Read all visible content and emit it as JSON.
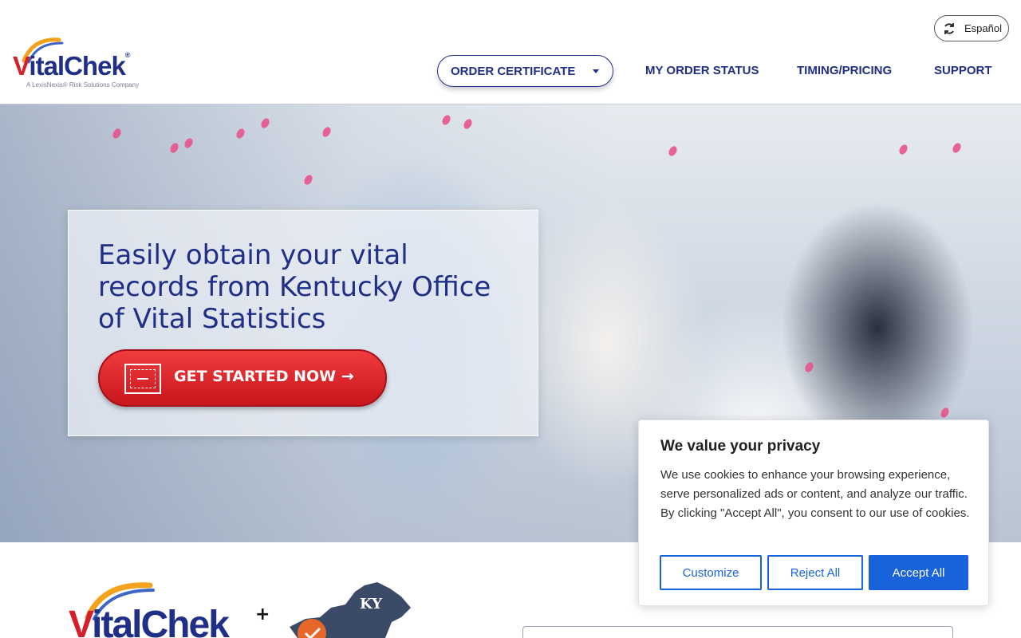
{
  "brand": {
    "logo_word": "VitalChek",
    "logo_tagline": "A LexisNexis® Risk Solutions Company",
    "colors": {
      "primary_navy": "#1f2e86",
      "brand_red": "#d41f2a",
      "cookie_blue": "#1863dc"
    }
  },
  "header": {
    "language_button": {
      "icon": "refresh-icon",
      "label": "Español"
    },
    "nav": {
      "order_certificate": "ORDER CERTIFICATE",
      "order_status": "MY ORDER STATUS",
      "timing_pricing": "TIMING/PRICING",
      "support": "SUPPORT"
    }
  },
  "hero": {
    "title": "Easily obtain your vital records from Kentucky Office of Vital Statistics",
    "cta_label": "GET STARTED NOW →",
    "cta_icon": "certificate-icon"
  },
  "partner": {
    "plus": "+",
    "state_abbr": "KY"
  },
  "cookie_banner": {
    "title": "We value your privacy",
    "body": "We use cookies to enhance your browsing experience, serve personalized ads or content, and analyze our traffic. By clicking \"Accept All\", you consent to our use of cookies.",
    "customize": "Customize",
    "reject": "Reject All",
    "accept": "Accept All"
  }
}
